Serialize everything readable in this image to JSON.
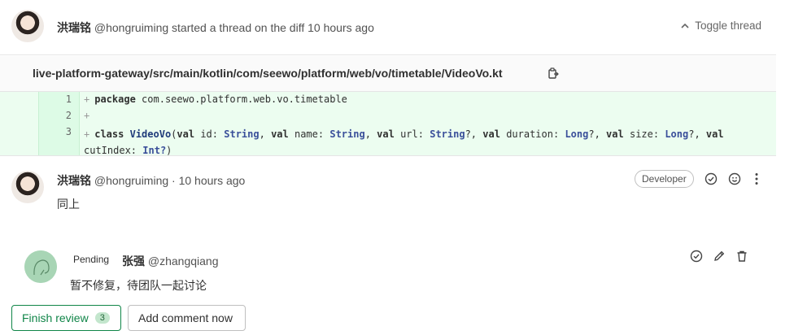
{
  "thread": {
    "author_name": "洪瑞铭",
    "author_handle": "@hongruiming",
    "action_text": "started a thread on the diff 10 hours ago",
    "toggle_label": "Toggle thread"
  },
  "file": {
    "path": "live-platform-gateway/src/main/kotlin/com/seewo/platform/web/vo/timetable/VideoVo.kt"
  },
  "diff": {
    "lines": [
      {
        "num": "1",
        "kw": "package",
        "rest": "com.seewo.platform.web.vo.timetable"
      },
      {
        "num": "2"
      },
      {
        "num": "3"
      }
    ],
    "class_line": {
      "kw_class": "class",
      "class_name": "VideoVo",
      "p1": "(",
      "kw_val": "val",
      "f1": "id:",
      "t1": "String",
      "f2": "name:",
      "t2": "String",
      "f3": "url:",
      "t3": "String",
      "q3": "?,",
      "f4": "duration:",
      "t4": "Long",
      "q4": "?,",
      "f5": "size:",
      "t5": "Long",
      "q5": "?,",
      "f6": "cutIndex:",
      "t6": "Int?",
      "close": ")"
    }
  },
  "comment": {
    "author_name": "洪瑞铭",
    "author_handle": "@hongruiming",
    "time": "· 10 hours ago",
    "role": "Developer",
    "body": "同上"
  },
  "draft": {
    "pending": "Pending",
    "author_name": "张强",
    "author_handle": "@zhangqiang",
    "body": "暂不修复，待团队一起讨论"
  },
  "buttons": {
    "finish_review": "Finish review",
    "finish_count": "3",
    "add_comment": "Add comment now"
  }
}
